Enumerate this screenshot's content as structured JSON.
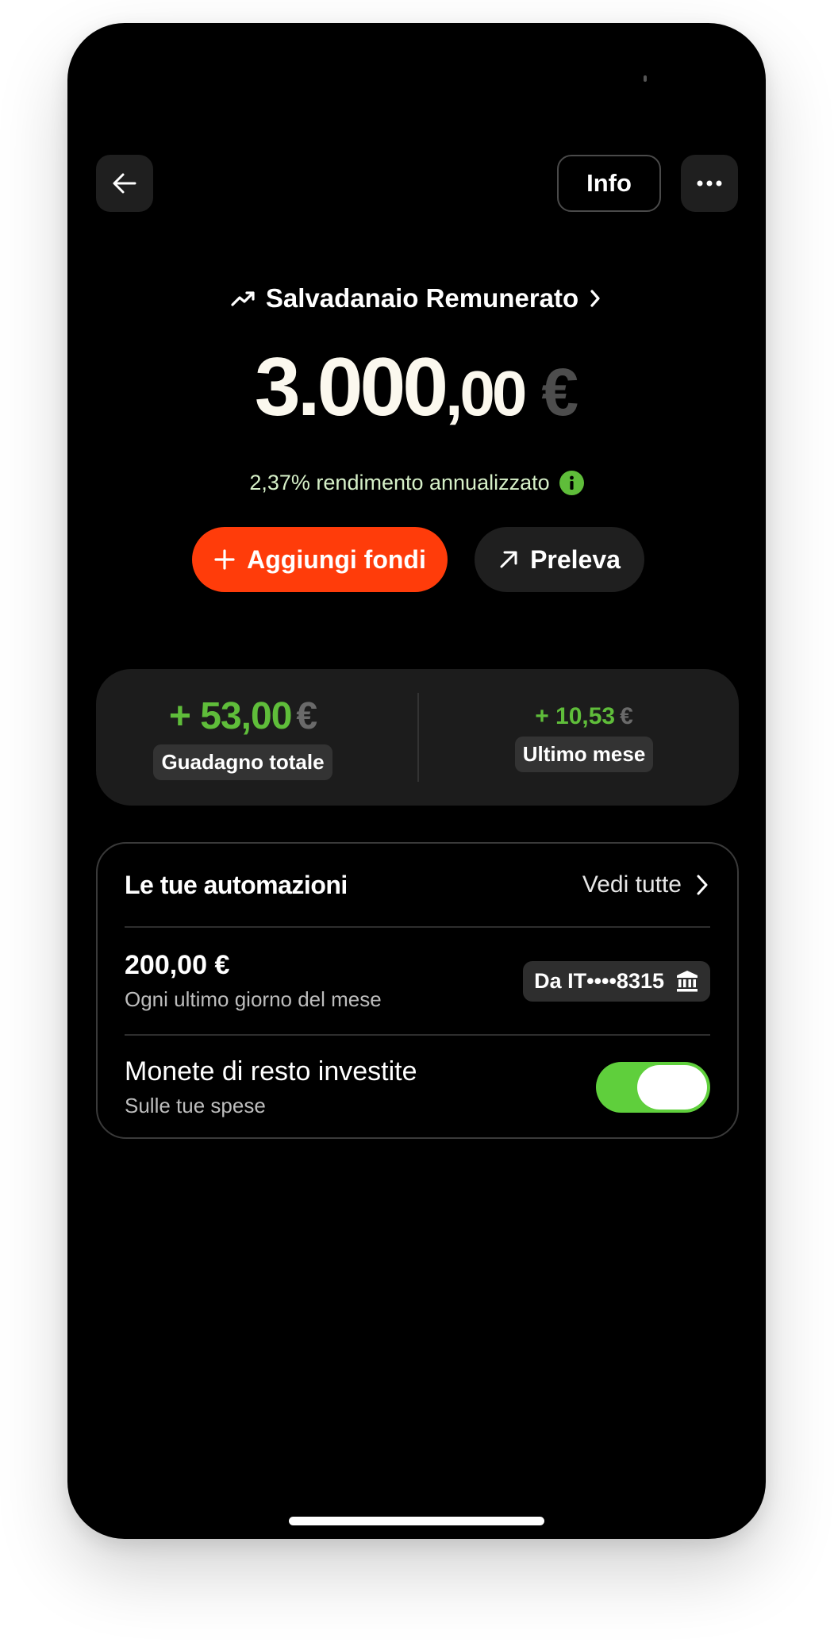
{
  "header": {
    "info_label": "Info"
  },
  "product": {
    "name": "Salvadanaio Remunerato"
  },
  "balance": {
    "integer": "3.000",
    "decimals": ",00",
    "currency": "€"
  },
  "rate": {
    "text": "2,37% rendimento annualizzato"
  },
  "actions": {
    "add_label": "Aggiungi fondi",
    "withdraw_label": "Preleva"
  },
  "stats": {
    "total": {
      "value": "+ 53,00",
      "currency": "€",
      "label": "Guadagno totale"
    },
    "month": {
      "value": "+ 10,53",
      "currency": "€",
      "label": "Ultimo mese"
    }
  },
  "automations": {
    "title": "Le tue automazioni",
    "see_all": "Vedi tutte",
    "items": [
      {
        "title": "200,00 €",
        "subtitle": "Ogni ultimo giorno del mese",
        "chip": "Da IT••••8315"
      },
      {
        "title": "Monete di resto investite",
        "subtitle": "Sulle tue spese",
        "toggle_on": true
      }
    ]
  },
  "colors": {
    "accent": "#ff3c0a",
    "positive": "#5fbd3a",
    "toggle": "#5fcf3c",
    "background": "#000000",
    "card": "#1c1c1c"
  },
  "icons": [
    "arrow-left-icon",
    "ellipsis-icon",
    "trend-up-icon",
    "chevron-right-icon",
    "info-icon",
    "plus-icon",
    "arrow-up-right-icon",
    "bank-icon"
  ]
}
